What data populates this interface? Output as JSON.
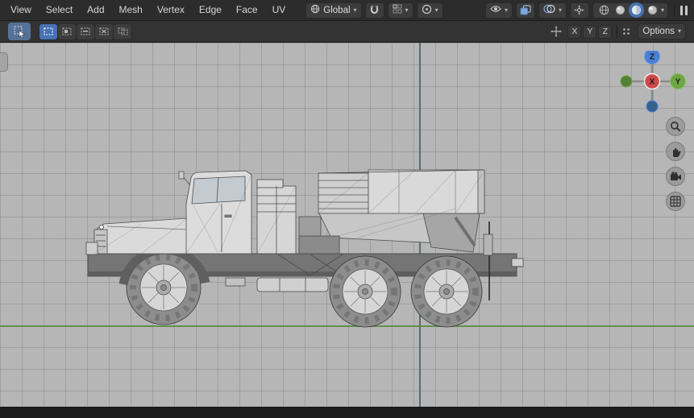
{
  "menubar": {
    "menus": [
      "View",
      "Select",
      "Add",
      "Mesh",
      "Vertex",
      "Edge",
      "Face",
      "UV"
    ]
  },
  "header": {
    "orientation_label": "Global"
  },
  "tool_settings": {
    "mirror": {
      "x": "X",
      "y": "Y",
      "z": "Z"
    },
    "options_label": "Options"
  },
  "gizmo": {
    "axis_labels": {
      "z": "Z",
      "y": "Y",
      "x": "X"
    }
  },
  "icons": {
    "chevron_down": "▾"
  },
  "colors": {
    "accent": "#4772b3",
    "axis_x": "#cf4848",
    "axis_y": "#6fa644",
    "axis_z": "#4a7fd6",
    "viewport_bg": "#b6b6b6",
    "vertical_axis_line": "#44606f",
    "horizontal_axis_line": "#5d8a43"
  }
}
